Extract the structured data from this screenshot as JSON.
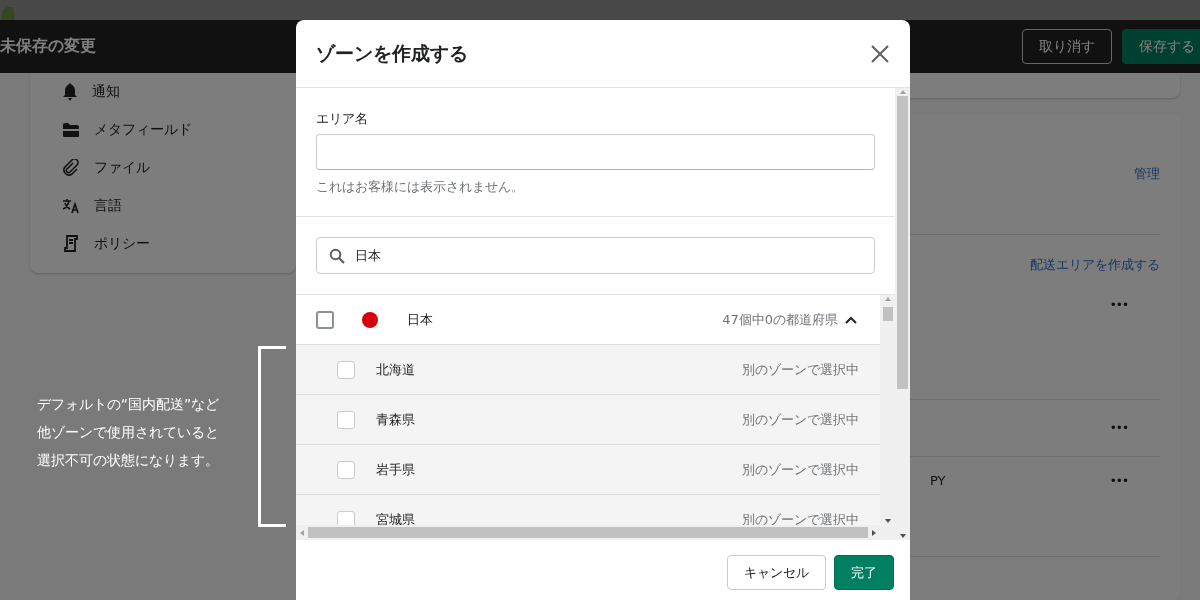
{
  "save_bar": {
    "title": "未保存の変更",
    "buttons": [
      {
        "label": "取り消す",
        "kind": "secondary"
      },
      {
        "label": "保存する",
        "kind": "primary"
      }
    ]
  },
  "sidebar": {
    "items": [
      {
        "label": "通知"
      },
      {
        "label": "メタフィールド"
      },
      {
        "label": "ファイル"
      },
      {
        "label": "言語"
      },
      {
        "label": "ポリシー"
      }
    ]
  },
  "shipping_card": {
    "manage_link": "管理",
    "create_link": "配送エリアを作成する",
    "zones": [
      {
        "menu": "•••"
      },
      {
        "menu": "•••"
      },
      {
        "text": "PY",
        "menu": "•••"
      }
    ]
  },
  "modal": {
    "title": "ゾーンを作成する",
    "name_field": {
      "label": "エリア名",
      "help": "これはお客様には表示されません。"
    },
    "search": {
      "value": "日本"
    },
    "country": {
      "name": "日本",
      "summary": "47個中0の都道府県",
      "checked": false,
      "expanded": true,
      "children": [
        {
          "name": "北海道",
          "status": "別のゾーンで選択中",
          "checked": false,
          "disabled": true
        },
        {
          "name": "青森県",
          "status": "別のゾーンで選択中",
          "checked": false,
          "disabled": true
        },
        {
          "name": "岩手県",
          "status": "別のゾーンで選択中",
          "checked": false,
          "disabled": true
        },
        {
          "name": "宮城県",
          "status": "別のゾーンで選択中",
          "checked": false,
          "disabled": true
        }
      ]
    },
    "buttons": [
      {
        "label": "キャンセル",
        "kind": "secondary"
      },
      {
        "label": "完了",
        "kind": "primary"
      }
    ]
  },
  "annotation": {
    "lines": [
      "デフォルトの“国内配送”など",
      "他ゾーンで使用されていると",
      "選択不可の状態になります。"
    ]
  }
}
